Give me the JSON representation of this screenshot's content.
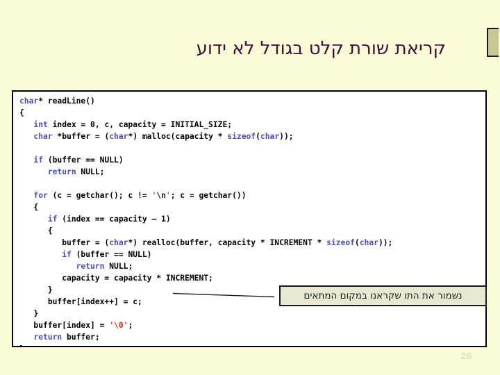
{
  "slide": {
    "title": "קריאת שורת קלט בגודל לא ידוע",
    "page_number": "26",
    "title_color": "#3a1138",
    "background_color": "#fbfbd8",
    "marker_color": "#c7c78f"
  },
  "code": {
    "language": "c",
    "function_name": "readLine",
    "keyword_color": "#4a50b4",
    "string_color": "#a06030",
    "background_color": "#ffffff",
    "border_color": "#000000",
    "lines": [
      {
        "indent": 0,
        "tokens": [
          {
            "t": "char",
            "c": "kw"
          },
          {
            "t": "* readLine()",
            "c": ""
          }
        ]
      },
      {
        "indent": 0,
        "tokens": [
          {
            "t": "{",
            "c": ""
          }
        ]
      },
      {
        "indent": 1,
        "tokens": [
          {
            "t": "int",
            "c": "kw"
          },
          {
            "t": " index = 0, c, capacity = INITIAL_SIZE;",
            "c": ""
          }
        ]
      },
      {
        "indent": 1,
        "tokens": [
          {
            "t": "char",
            "c": "kw"
          },
          {
            "t": " *buffer = (",
            "c": ""
          },
          {
            "t": "char",
            "c": "kw"
          },
          {
            "t": "*) malloc(capacity * ",
            "c": ""
          },
          {
            "t": "sizeof",
            "c": "kw"
          },
          {
            "t": "(",
            "c": ""
          },
          {
            "t": "char",
            "c": "kw"
          },
          {
            "t": "));",
            "c": ""
          }
        ]
      },
      {
        "indent": 0,
        "tokens": []
      },
      {
        "indent": 1,
        "tokens": [
          {
            "t": "if",
            "c": "kw"
          },
          {
            "t": " (buffer == NULL)",
            "c": ""
          }
        ]
      },
      {
        "indent": 2,
        "tokens": [
          {
            "t": "return",
            "c": "kw"
          },
          {
            "t": " NULL;",
            "c": ""
          }
        ]
      },
      {
        "indent": 0,
        "tokens": []
      },
      {
        "indent": 1,
        "tokens": [
          {
            "t": "for",
            "c": "kw"
          },
          {
            "t": " (c = getchar(); c != ",
            "c": ""
          },
          {
            "t": "'",
            "c": "str"
          },
          {
            "t": "\\n",
            "c": "esc"
          },
          {
            "t": "'",
            "c": "str"
          },
          {
            "t": "; c = getchar())",
            "c": ""
          }
        ]
      },
      {
        "indent": 1,
        "tokens": [
          {
            "t": "{",
            "c": ""
          }
        ]
      },
      {
        "indent": 2,
        "tokens": [
          {
            "t": "if",
            "c": "kw"
          },
          {
            "t": " (index == capacity – 1)",
            "c": ""
          }
        ]
      },
      {
        "indent": 2,
        "tokens": [
          {
            "t": "{",
            "c": ""
          }
        ]
      },
      {
        "indent": 3,
        "tokens": [
          {
            "t": "buffer = (",
            "c": ""
          },
          {
            "t": "char",
            "c": "kw"
          },
          {
            "t": "*) realloc(buffer, capacity * INCREMENT * ",
            "c": ""
          },
          {
            "t": "sizeof",
            "c": "kw"
          },
          {
            "t": "(",
            "c": ""
          },
          {
            "t": "char",
            "c": "kw"
          },
          {
            "t": "));",
            "c": ""
          }
        ]
      },
      {
        "indent": 3,
        "tokens": [
          {
            "t": "if",
            "c": "kw"
          },
          {
            "t": " (buffer == NULL)",
            "c": ""
          }
        ]
      },
      {
        "indent": 4,
        "tokens": [
          {
            "t": "return",
            "c": "kw"
          },
          {
            "t": " NULL;",
            "c": ""
          }
        ]
      },
      {
        "indent": 3,
        "tokens": [
          {
            "t": "capacity = capacity * INCREMENT;",
            "c": ""
          }
        ]
      },
      {
        "indent": 2,
        "tokens": [
          {
            "t": "}",
            "c": ""
          }
        ]
      },
      {
        "indent": 2,
        "tokens": [
          {
            "t": "buffer[index++] = c;",
            "c": ""
          }
        ]
      },
      {
        "indent": 1,
        "tokens": [
          {
            "t": "}",
            "c": ""
          }
        ]
      },
      {
        "indent": 1,
        "tokens": [
          {
            "t": "buffer[index] = ",
            "c": ""
          },
          {
            "t": "'",
            "c": "str0"
          },
          {
            "t": "\\0",
            "c": "str0"
          },
          {
            "t": "'",
            "c": "str0"
          },
          {
            "t": ";",
            "c": ""
          }
        ]
      },
      {
        "indent": 1,
        "tokens": [
          {
            "t": "return",
            "c": "kw"
          },
          {
            "t": " buffer;",
            "c": ""
          }
        ]
      },
      {
        "indent": 0,
        "tokens": [
          {
            "t": "}",
            "c": ""
          }
        ]
      }
    ]
  },
  "callout": {
    "text": "נשמור את התו שקראנו במקום המתאים",
    "background_color": "#e8e8d2",
    "border_color": "#1a1a1a",
    "text_color": "#14261a"
  }
}
